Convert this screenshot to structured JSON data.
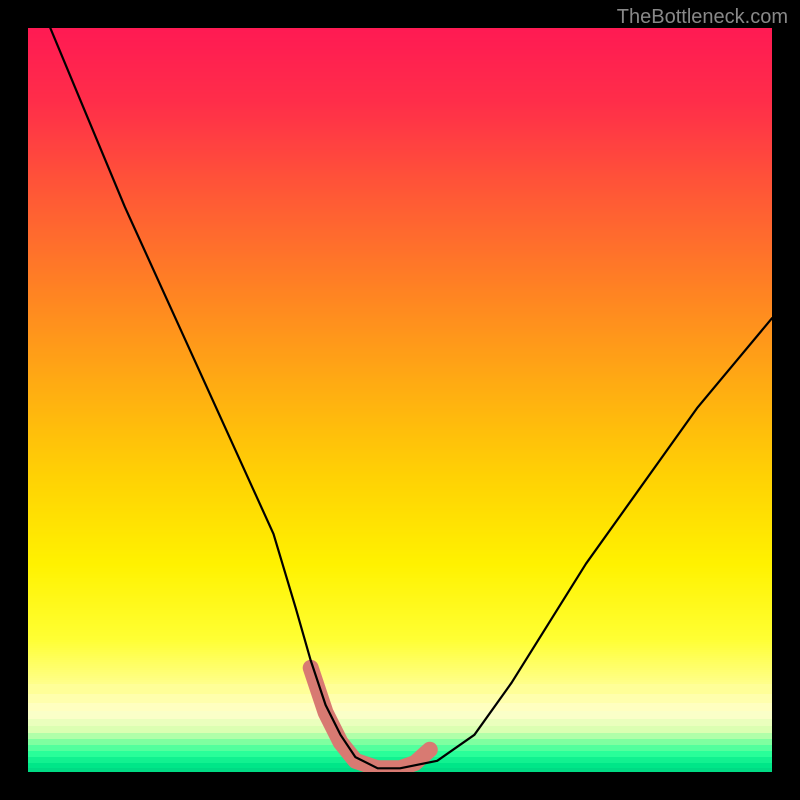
{
  "watermark": "TheBottleneck.com",
  "chart_data": {
    "type": "line",
    "title": "",
    "xlabel": "",
    "ylabel": "",
    "xlim": [
      0,
      100
    ],
    "ylim": [
      0,
      100
    ],
    "series": [
      {
        "name": "curve",
        "x": [
          3,
          8,
          13,
          18,
          23,
          28,
          33,
          36,
          38,
          40,
          42,
          44,
          47,
          50,
          55,
          60,
          65,
          70,
          75,
          80,
          85,
          90,
          95,
          100
        ],
        "y": [
          100,
          88,
          76,
          65,
          54,
          43,
          32,
          22,
          15,
          9,
          5,
          2,
          0.5,
          0.5,
          1.5,
          5,
          12,
          20,
          28,
          35,
          42,
          49,
          55,
          61
        ]
      }
    ],
    "valley_marker": {
      "name": "highlight",
      "x": [
        38,
        40,
        42,
        44,
        47,
        50,
        52,
        54
      ],
      "y": [
        14,
        8,
        4,
        1.5,
        0.5,
        0.5,
        1.2,
        3
      ]
    },
    "background_gradient": {
      "description": "vertical red-yellow-green heat gradient with green band at bottom",
      "stops": [
        {
          "pos": 0.0,
          "color": "#ff1a53"
        },
        {
          "pos": 0.1,
          "color": "#ff2e49"
        },
        {
          "pos": 0.22,
          "color": "#ff5836"
        },
        {
          "pos": 0.35,
          "color": "#ff8223"
        },
        {
          "pos": 0.48,
          "color": "#ffac12"
        },
        {
          "pos": 0.6,
          "color": "#ffd104"
        },
        {
          "pos": 0.72,
          "color": "#fff200"
        },
        {
          "pos": 0.82,
          "color": "#ffff33"
        },
        {
          "pos": 0.88,
          "color": "#ffff8a"
        },
        {
          "pos": 0.92,
          "color": "#ffffcc"
        },
        {
          "pos": 0.945,
          "color": "#d8ffb0"
        },
        {
          "pos": 0.96,
          "color": "#7dffa0"
        },
        {
          "pos": 0.975,
          "color": "#2bff9a"
        },
        {
          "pos": 0.99,
          "color": "#00e889"
        },
        {
          "pos": 1.0,
          "color": "#00d883"
        }
      ]
    },
    "highlight_color": "#d87a72",
    "curve_color": "#000000"
  }
}
